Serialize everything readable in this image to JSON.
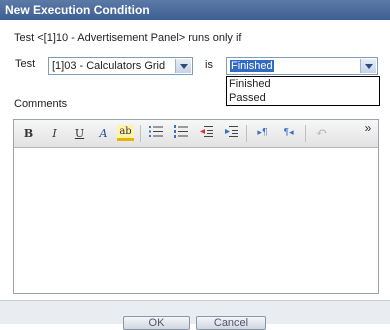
{
  "window": {
    "title": "New Execution Condition"
  },
  "condition": {
    "sentence": "Test <[1]10 - Advertisement Panel> runs only if",
    "test_label": "Test",
    "test_value": "[1]03 - Calculators Grid",
    "is_label": "is",
    "status_value": "Finished",
    "status_options": [
      "Finished",
      "Passed"
    ]
  },
  "comments": {
    "label": "Comments",
    "toolbar": {
      "bold": "B",
      "italic": "I",
      "underline": "U",
      "font_color": "A",
      "highlight": "ab",
      "more": "»"
    },
    "body": ""
  },
  "footer": {
    "ok_label": "OK",
    "cancel_label": "Cancel"
  }
}
